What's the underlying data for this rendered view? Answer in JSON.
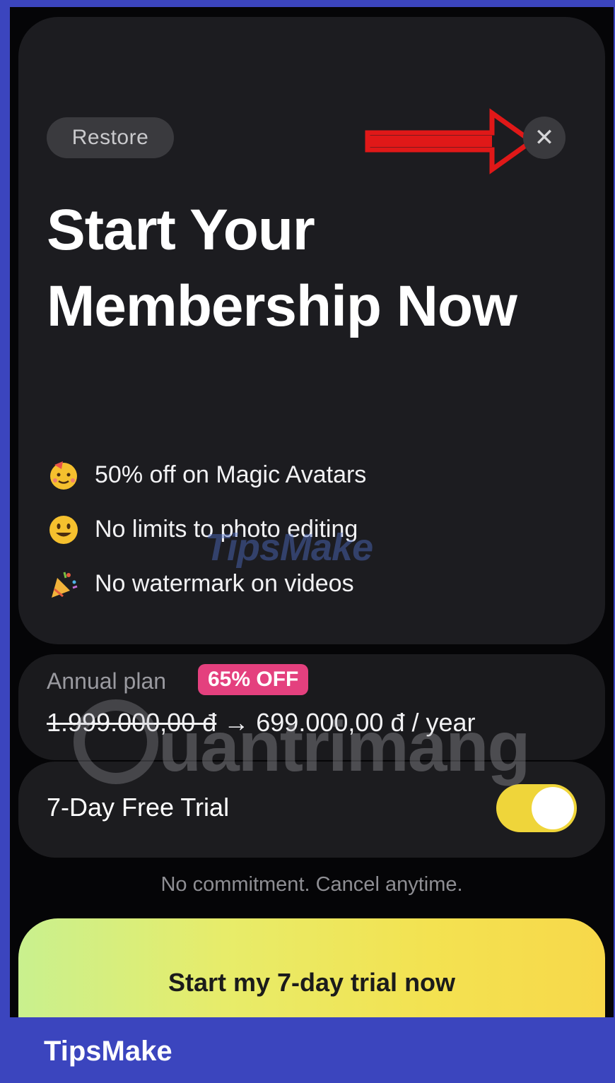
{
  "header": {
    "restore_label": "Restore",
    "close_glyph": "✕"
  },
  "headline": "Start Your Membership Now",
  "features": [
    {
      "icon": "party-face-emoji-icon",
      "text": "50% off on Magic Avatars"
    },
    {
      "icon": "smiley-emoji-icon",
      "text": "No limits to photo editing"
    },
    {
      "icon": "party-popper-emoji-icon",
      "text": "No watermark on videos"
    }
  ],
  "plan": {
    "label": "Annual plan",
    "badge": "65% OFF",
    "old_price": "1.999.000,00 đ",
    "arrow": "→",
    "new_price": "699.000,00 đ / year"
  },
  "trial": {
    "label": "7-Day Free Trial",
    "enabled": true
  },
  "commitment_text": "No commitment. Cancel anytime.",
  "cta_label": "Start my 7-day trial now",
  "watermarks": {
    "mid": "TipsMake",
    "big": "uantrimang"
  },
  "footer_brand": "TipsMake",
  "colors": {
    "page_background": "#3b45be",
    "badge": "#e4407e",
    "toggle_on": "#efd53a",
    "annotation_arrow": "#e01818"
  }
}
